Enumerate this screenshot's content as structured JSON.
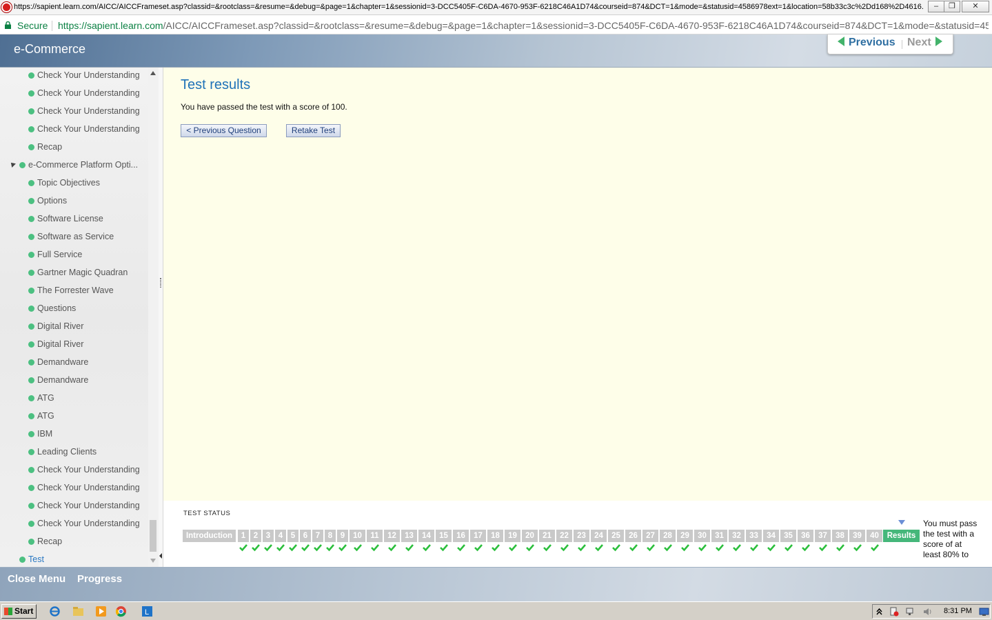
{
  "window": {
    "title": "https://sapient.learn.com/AICC/AICCFrameset.asp?classid=&rootclass=&resume=&debug=&page=1&chapter=1&sessionid=3-DCC5405F-C6DA-4670-953F-6218C46A1D74&courseid=874&DCT=1&mode=&statusid=4586978ext=1&location=58b33c3c%2Dd168%2D4616..."
  },
  "address": {
    "secure_label": "Secure",
    "url_host": "https://sapient.learn.com",
    "url_path": "/AICC/AICCFrameset.asp?classid=&rootclass=&resume=&debug=&page=1&chapter=1&sessionid=3-DCC5405F-C6DA-4670-953F-6218C46A1D74&courseid=874&DCT=1&mode=&statusid=45..."
  },
  "header": {
    "course_title": "e-Commerce",
    "previous_label": "Previous",
    "next_label": "Next"
  },
  "sidebar": {
    "items": [
      {
        "label": "Check Your Understanding"
      },
      {
        "label": "Check Your Understanding"
      },
      {
        "label": "Check Your Understanding"
      },
      {
        "label": "Check Your Understanding"
      },
      {
        "label": "Recap"
      },
      {
        "label": "e-Commerce Platform Opti..."
      },
      {
        "label": "Topic Objectives"
      },
      {
        "label": "Options"
      },
      {
        "label": "Software License"
      },
      {
        "label": "Software as Service"
      },
      {
        "label": "Full Service"
      },
      {
        "label": "Gartner Magic Quadran"
      },
      {
        "label": "The Forrester Wave"
      },
      {
        "label": "Questions"
      },
      {
        "label": "Digital River"
      },
      {
        "label": "Digital River"
      },
      {
        "label": "Demandware"
      },
      {
        "label": "Demandware"
      },
      {
        "label": "ATG"
      },
      {
        "label": "ATG"
      },
      {
        "label": "IBM"
      },
      {
        "label": "Leading Clients"
      },
      {
        "label": "Check Your Understanding"
      },
      {
        "label": "Check Your Understanding"
      },
      {
        "label": "Check Your Understanding"
      },
      {
        "label": "Check Your Understanding"
      },
      {
        "label": "Recap"
      },
      {
        "label": "Test"
      }
    ]
  },
  "main": {
    "title": "Test results",
    "result_text": "You have passed the test with a score of 100.",
    "prev_question_label": "< Previous Question",
    "retake_label": "Retake Test"
  },
  "test_status": {
    "title": "TEST STATUS",
    "intro_label": "Introduction",
    "questions": [
      "1",
      "2",
      "3",
      "4",
      "5",
      "6",
      "7",
      "8",
      "9",
      "10",
      "11",
      "12",
      "13",
      "14",
      "15",
      "16",
      "17",
      "18",
      "19",
      "20",
      "21",
      "22",
      "23",
      "24",
      "25",
      "26",
      "27",
      "28",
      "29",
      "30",
      "31",
      "32",
      "33",
      "34",
      "35",
      "36",
      "37",
      "38",
      "39",
      "40"
    ],
    "results_label": "Results",
    "note": "You must pass the test with a score of at least 80% to",
    "check_color": "#2bbf3c",
    "results_color": "#45b77a"
  },
  "bottom": {
    "close_menu_label": "Close Menu",
    "progress_label": "Progress"
  },
  "taskbar": {
    "start_label": "Start",
    "clock": "8:31 PM"
  },
  "colors": {
    "accent_green": "#4cc081",
    "link_blue": "#1f72b8",
    "content_bg": "#fefee9"
  }
}
